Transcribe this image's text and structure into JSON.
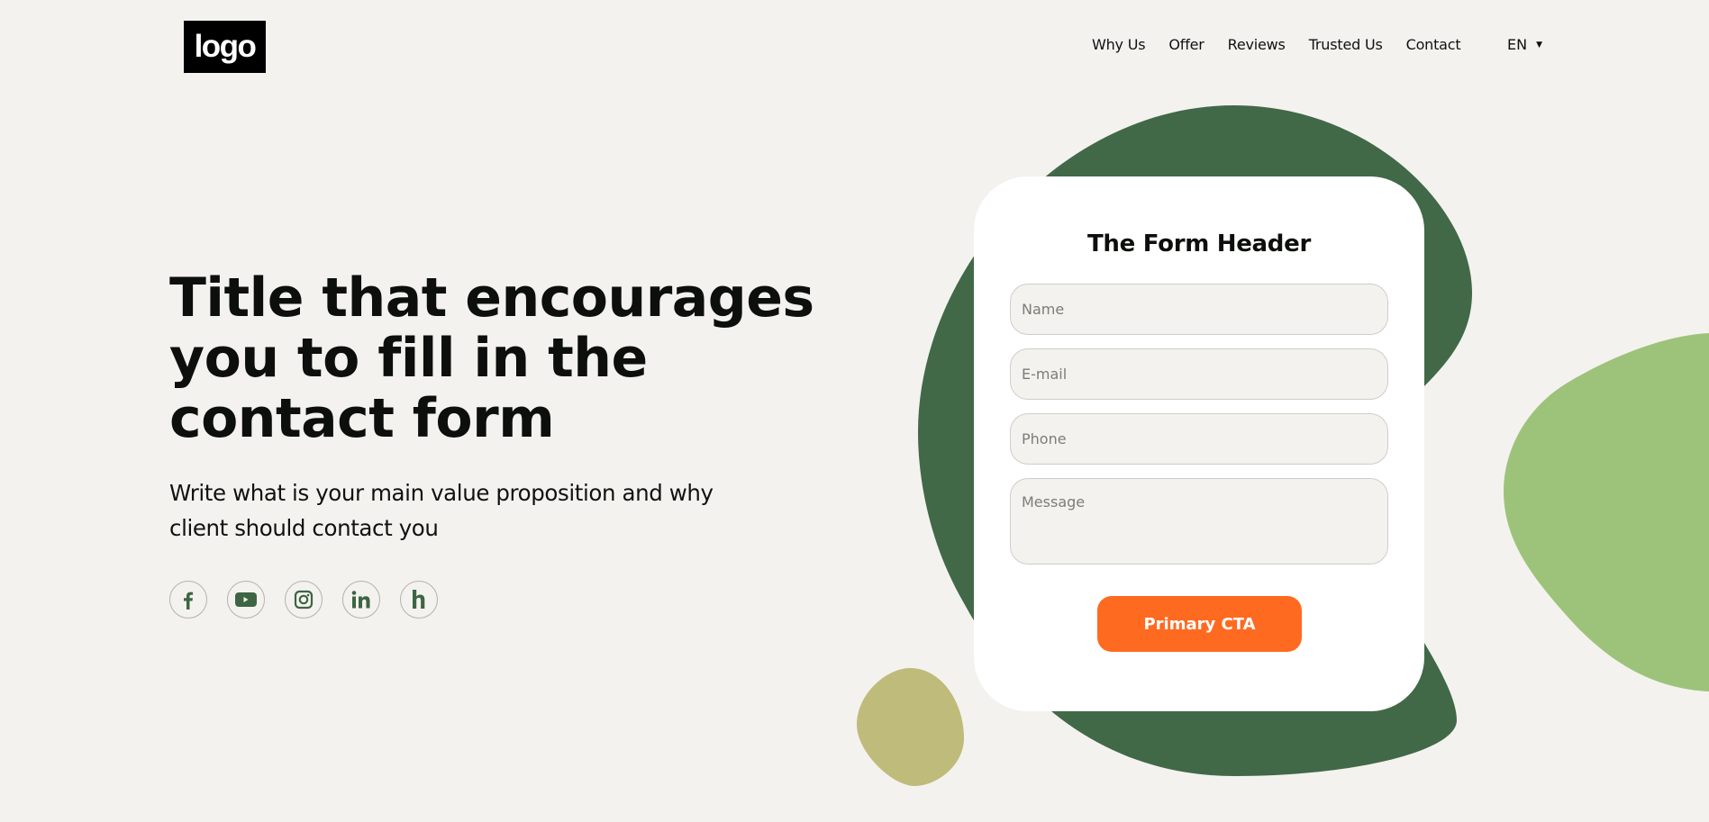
{
  "header": {
    "logo_text": "logo",
    "nav": [
      {
        "label": "Why Us"
      },
      {
        "label": "Offer"
      },
      {
        "label": "Reviews"
      },
      {
        "label": "Trusted Us"
      },
      {
        "label": "Contact"
      }
    ],
    "language": {
      "selected": "EN",
      "icon": "caret-down-icon"
    }
  },
  "hero": {
    "title": "Title that encourages you to fill in the contact form",
    "subtitle": "Write what is your main value proposition and why client should contact you",
    "social": [
      {
        "name": "facebook",
        "icon": "facebook-icon"
      },
      {
        "name": "youtube",
        "icon": "youtube-icon"
      },
      {
        "name": "instagram",
        "icon": "instagram-icon"
      },
      {
        "name": "linkedin",
        "icon": "linkedin-icon"
      },
      {
        "name": "houzz",
        "icon": "houzz-icon"
      }
    ]
  },
  "form": {
    "header": "The Form Header",
    "fields": {
      "name": {
        "placeholder": "Name",
        "value": ""
      },
      "email": {
        "placeholder": "E-mail",
        "value": ""
      },
      "phone": {
        "placeholder": "Phone",
        "value": ""
      },
      "message": {
        "placeholder": "Message",
        "value": ""
      }
    },
    "cta_label": "Primary CTA"
  },
  "colors": {
    "background": "#f4f2ee",
    "dark_green": "#416948",
    "light_green": "#9dc37a",
    "olive": "#bfbb7a",
    "cta": "#ff6a21",
    "icon_green": "#3d6543"
  }
}
